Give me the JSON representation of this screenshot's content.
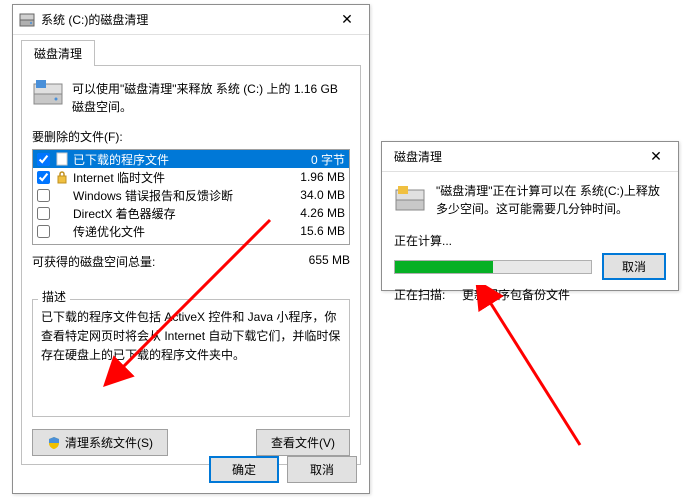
{
  "main_dialog": {
    "title": "系统 (C:)的磁盘清理",
    "tab_label": "磁盘清理",
    "info_text": "可以使用\"磁盘清理\"来释放 系统 (C:) 上的 1.16 GB 磁盘空间。",
    "files_label": "要删除的文件(F):",
    "files": [
      {
        "name": "已下载的程序文件",
        "size": "0 字节",
        "checked": true,
        "selected": true,
        "icon": "doc"
      },
      {
        "name": "Internet 临时文件",
        "size": "1.96 MB",
        "checked": true,
        "selected": false,
        "icon": "lock"
      },
      {
        "name": "Windows 错误报告和反馈诊断",
        "size": "34.0 MB",
        "checked": false,
        "selected": false,
        "icon": ""
      },
      {
        "name": "DirectX 着色器缓存",
        "size": "4.26 MB",
        "checked": false,
        "selected": false,
        "icon": ""
      },
      {
        "name": "传递优化文件",
        "size": "15.6 MB",
        "checked": false,
        "selected": false,
        "icon": ""
      }
    ],
    "total_label": "可获得的磁盘空间总量:",
    "total_value": "655 MB",
    "desc_label": "描述",
    "desc_text": "已下载的程序文件包括 ActiveX 控件和 Java 小程序，你查看特定网页时将会从 Internet 自动下载它们，并临时保存在硬盘上的已下载的程序文件夹中。",
    "clean_sys_btn": "清理系统文件(S)",
    "view_files_btn": "查看文件(V)",
    "ok_btn": "确定",
    "cancel_btn": "取消"
  },
  "progress_dialog": {
    "title": "磁盘清理",
    "info_text": "\"磁盘清理\"正在计算可以在 系统(C:)上释放多少空间。这可能需要几分钟时间。",
    "calculating": "正在计算...",
    "cancel_btn": "取消",
    "scanning_label": "正在扫描:",
    "scanning_value": "更新程序包备份文件"
  }
}
